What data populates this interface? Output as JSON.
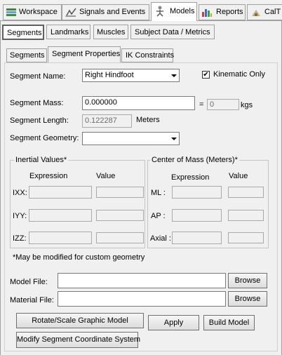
{
  "top_tabs": [
    {
      "label": "Workspace",
      "icon": "workspace-icon"
    },
    {
      "label": "Signals and Events",
      "icon": "signals-icon"
    },
    {
      "label": "Models",
      "icon": "models-icon"
    },
    {
      "label": "Reports",
      "icon": "reports-icon"
    },
    {
      "label": "CalT",
      "icon": "cal-icon"
    }
  ],
  "sub_tabs": [
    "Segments",
    "Landmarks",
    "Muscles",
    "Subject Data / Metrics"
  ],
  "inner_tabs": [
    "Segments",
    "Segment Properties",
    "IK Constraints"
  ],
  "form": {
    "segment_name_label": "Segment Name:",
    "segment_name_value": "Right Hindfoot",
    "kinematic_only_label": "Kinematic Only",
    "kinematic_only_checked": true,
    "segment_mass_label": "Segment Mass:",
    "segment_mass_value": "0.000000",
    "equals": "=",
    "mass_kgs_value": "0",
    "kgs_unit": "kgs",
    "segment_length_label": "Segment Length:",
    "segment_length_value": "0.122287",
    "meters_unit": "Meters",
    "segment_geometry_label": "Segment Geometry:",
    "segment_geometry_value": ""
  },
  "inertial": {
    "title": "Inertial Values*",
    "expression_header": "Expression",
    "value_header": "Value",
    "rows": [
      "IXX:",
      "IYY:",
      "IZZ:"
    ]
  },
  "com": {
    "title": "Center of Mass (Meters)*",
    "expression_header": "Expression",
    "value_header": "Value",
    "rows": [
      "ML :",
      "AP :",
      "Axial :"
    ]
  },
  "note": "*May be modified for custom geometry",
  "files": {
    "model_label": "Model File:",
    "model_value": "",
    "material_label": "Material File:",
    "material_value": "",
    "browse_label": "Browse"
  },
  "buttons": {
    "rotate_scale": "Rotate/Scale Graphic Model",
    "apply": "Apply",
    "build_model": "Build Model",
    "modify_coord": "Modify Segment Coordinate System"
  }
}
